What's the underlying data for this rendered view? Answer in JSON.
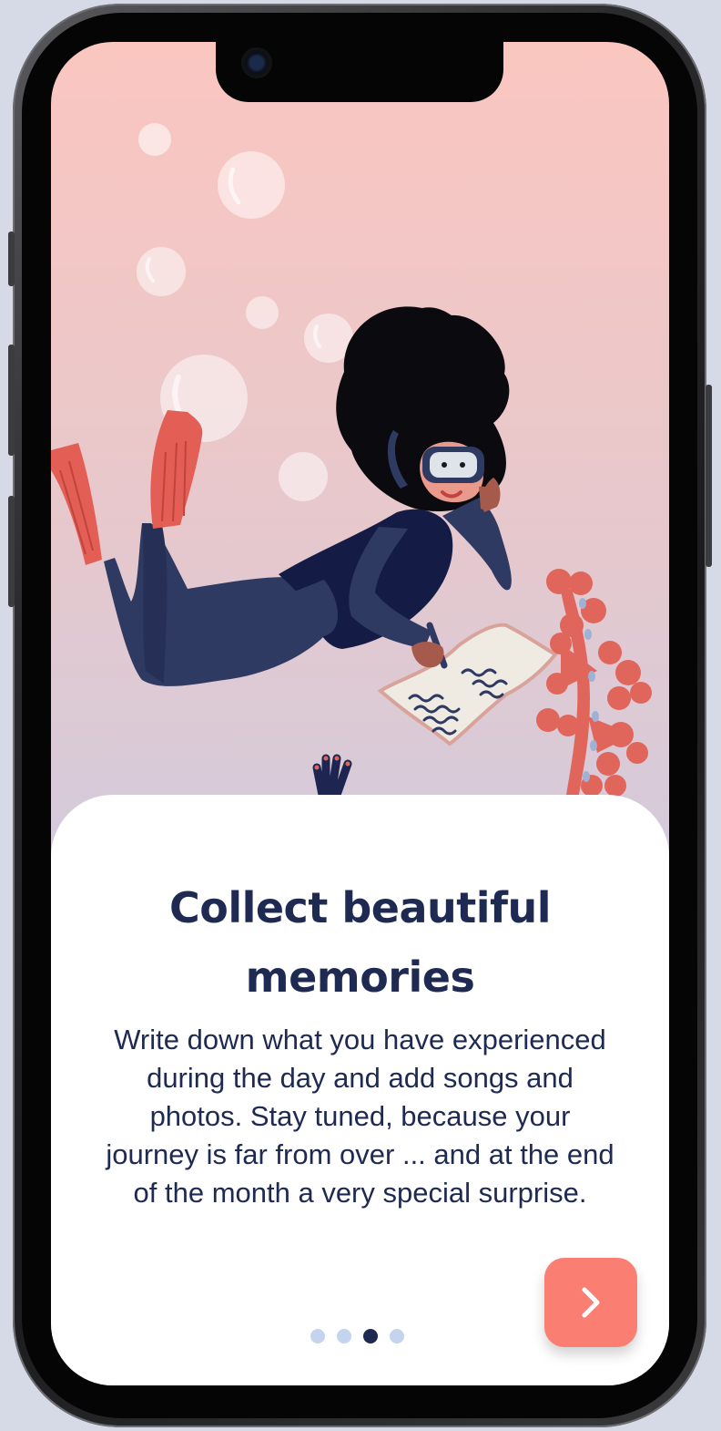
{
  "onboarding": {
    "title": "Collect beautiful memories",
    "description": "Write down what you have experienced during the day and add songs and photos. Stay tuned, because your journey is far from over ... and at the end of the month a very special surprise.",
    "pagination": {
      "total": 4,
      "current": 3
    },
    "next_button_icon": "chevron-right-icon"
  },
  "colors": {
    "title": "#1f2a52",
    "accent": "#fa7f72",
    "dot_inactive": "#c4d4ee",
    "dot_active": "#1f2a52",
    "background_top": "#fbc6c0",
    "background_bottom": "#c9cde0"
  },
  "illustration": "diver-writing-notes-underwater"
}
